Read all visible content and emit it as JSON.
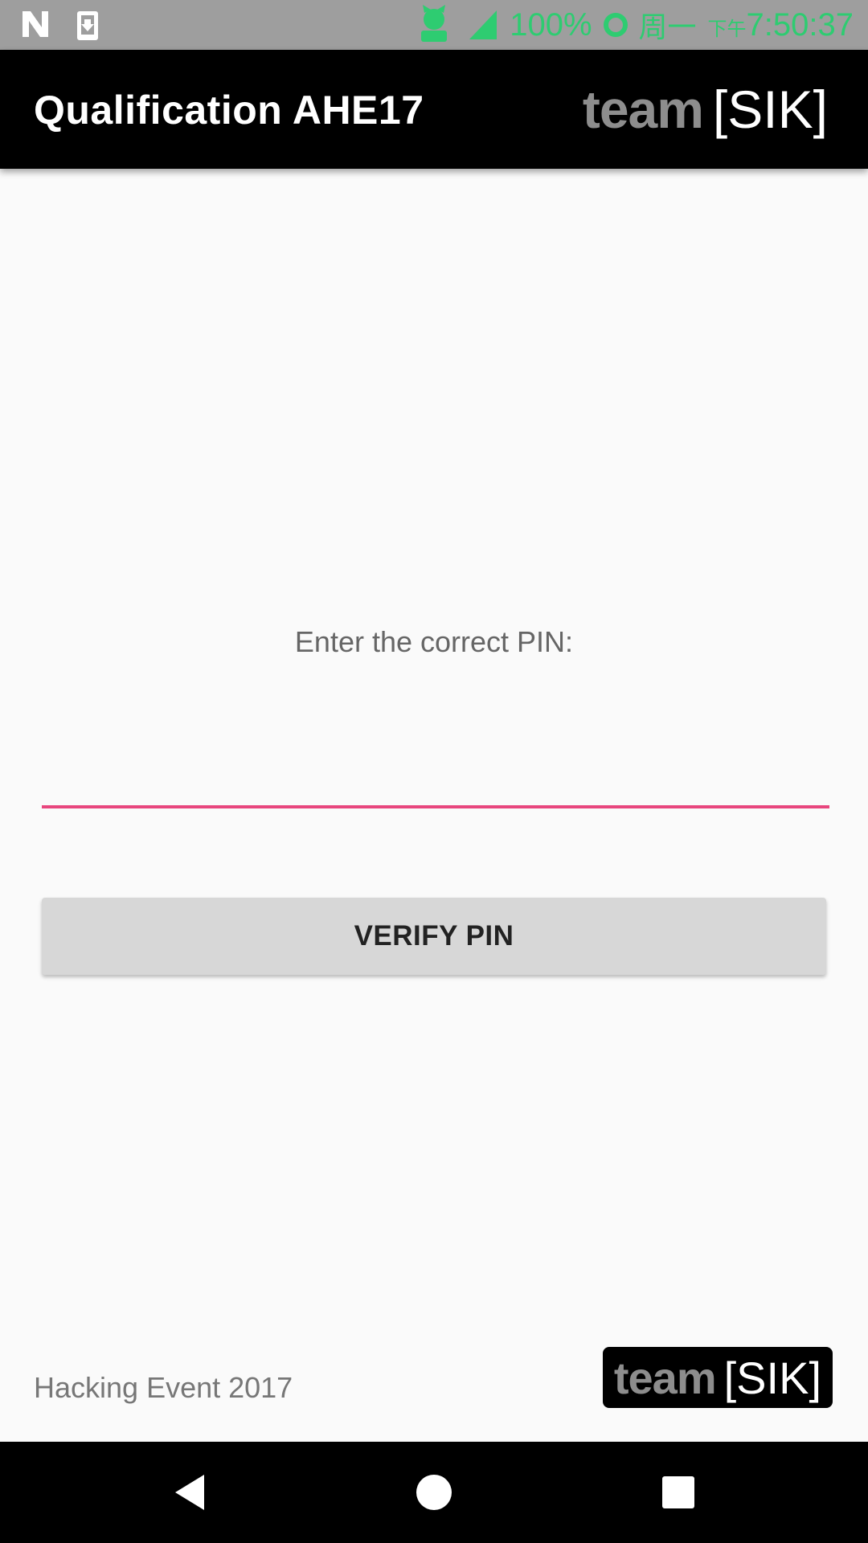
{
  "status_bar": {
    "battery": "100%",
    "day": "周一",
    "ampm": "下午",
    "time": "7:50:37",
    "icons": [
      "n-logo-icon",
      "download-icon",
      "cat-icon",
      "signal-icon",
      "ring-icon"
    ],
    "text_color": "#2ecc71"
  },
  "app_bar": {
    "title": "Qualification AHE17",
    "logo_team": "team",
    "logo_bracket_open": "[",
    "logo_sik": "SIK",
    "logo_bracket_close": "]"
  },
  "main": {
    "prompt": "Enter the correct PIN:",
    "pin_value": "",
    "verify_label": "VERIFY PIN",
    "accent_color": "#e8467e"
  },
  "footer": {
    "event_text": "Hacking Event 2017",
    "logo_team": "team",
    "logo_bracket_open": "[",
    "logo_sik": "SIK",
    "logo_bracket_close": "]"
  },
  "nav_bar": {
    "icons": [
      "back-icon",
      "home-icon",
      "recents-icon"
    ]
  }
}
